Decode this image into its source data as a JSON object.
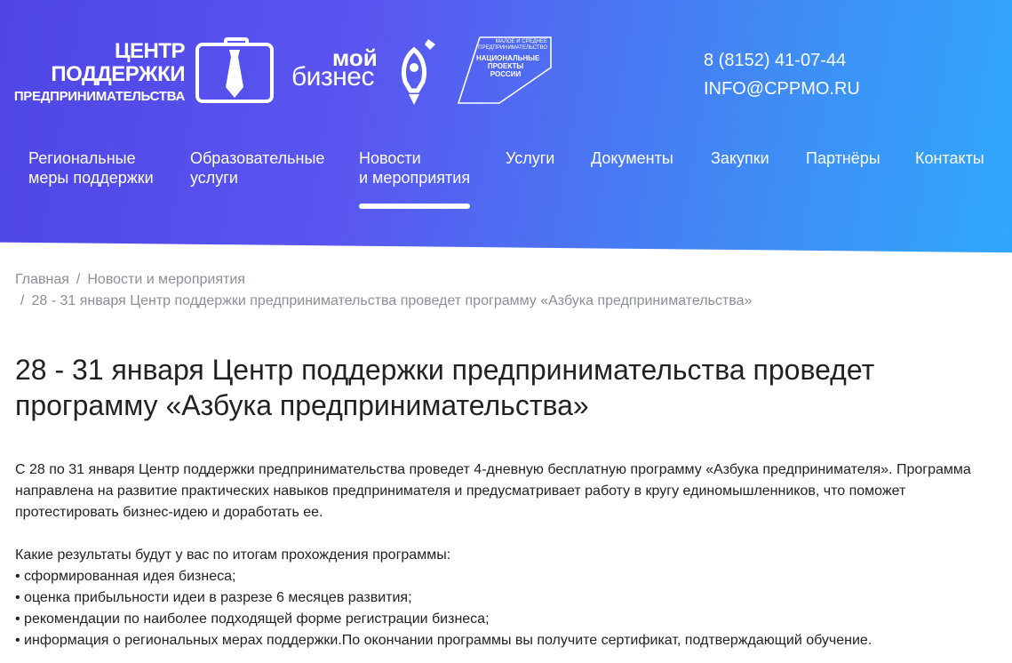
{
  "logos": {
    "centr": {
      "line1": "ЦЕНТР",
      "line2": "ПОДДЕРЖКИ",
      "line3": "ПРЕДПРИНИМАТЕЛЬСТВА",
      "icon": "briefcase-tie-icon"
    },
    "biz": {
      "moi": "мой",
      "biznes": "бизнес",
      "icon": "rocket-icon"
    },
    "np": {
      "top": "МАЛОЕ И СРЕДНЕЕ ПРЕДПРИНИМАТЕЛЬСТВО",
      "mid": "НАЦИОНАЛЬНЫЕ ПРОЕКТЫ РОССИИ"
    }
  },
  "contacts": {
    "phone": "8 (8152) 41-07-44",
    "email": "INFO@CPPMO.RU"
  },
  "nav": {
    "items": [
      {
        "line1": "Региональные",
        "line2": "меры поддержки"
      },
      {
        "line1": "Образовательные",
        "line2": "услуги"
      },
      {
        "line1": "Новости",
        "line2": "и мероприятия",
        "active": true
      },
      {
        "line1": "Услуги",
        "line2": ""
      },
      {
        "line1": "Документы",
        "line2": ""
      },
      {
        "line1": "Закупки",
        "line2": ""
      },
      {
        "line1": "Партнёры",
        "line2": ""
      },
      {
        "line1": "Контакты",
        "line2": ""
      }
    ]
  },
  "breadcrumbs": {
    "home": "Главная",
    "section": "Новости и мероприятия",
    "current": "28 - 31 января Центр поддержки предпринимательства проведет программу «Азбука предпринимательства»",
    "separator": "/"
  },
  "article": {
    "title": "28 - 31 января Центр поддержки предпринимательства проведет программу «Азбука предпринимательства»",
    "intro": "С 28 по 31 января Центр поддержки предпринимательства проведет 4-дневную бесплатную программу «Азбука предпринимателя». Программа направлена на развитие практических навыков предпринимателя и предусматривает работу в кругу единомышленников, что поможет протестировать бизнес-идею и доработать ее.",
    "results_heading": "Какие результаты будут у вас по итогам прохождения программы:",
    "bullets": [
      "• сформированная идея бизнеса;",
      "• оценка прибыльности идеи в разрезе 6 месяцев развития;",
      "• рекомендации по наиболее подходящей форме регистрации бизнеса;",
      "• информация о региональных мерах поддержки.По окончании программы вы получите сертификат, подтверждающий обучение."
    ]
  }
}
